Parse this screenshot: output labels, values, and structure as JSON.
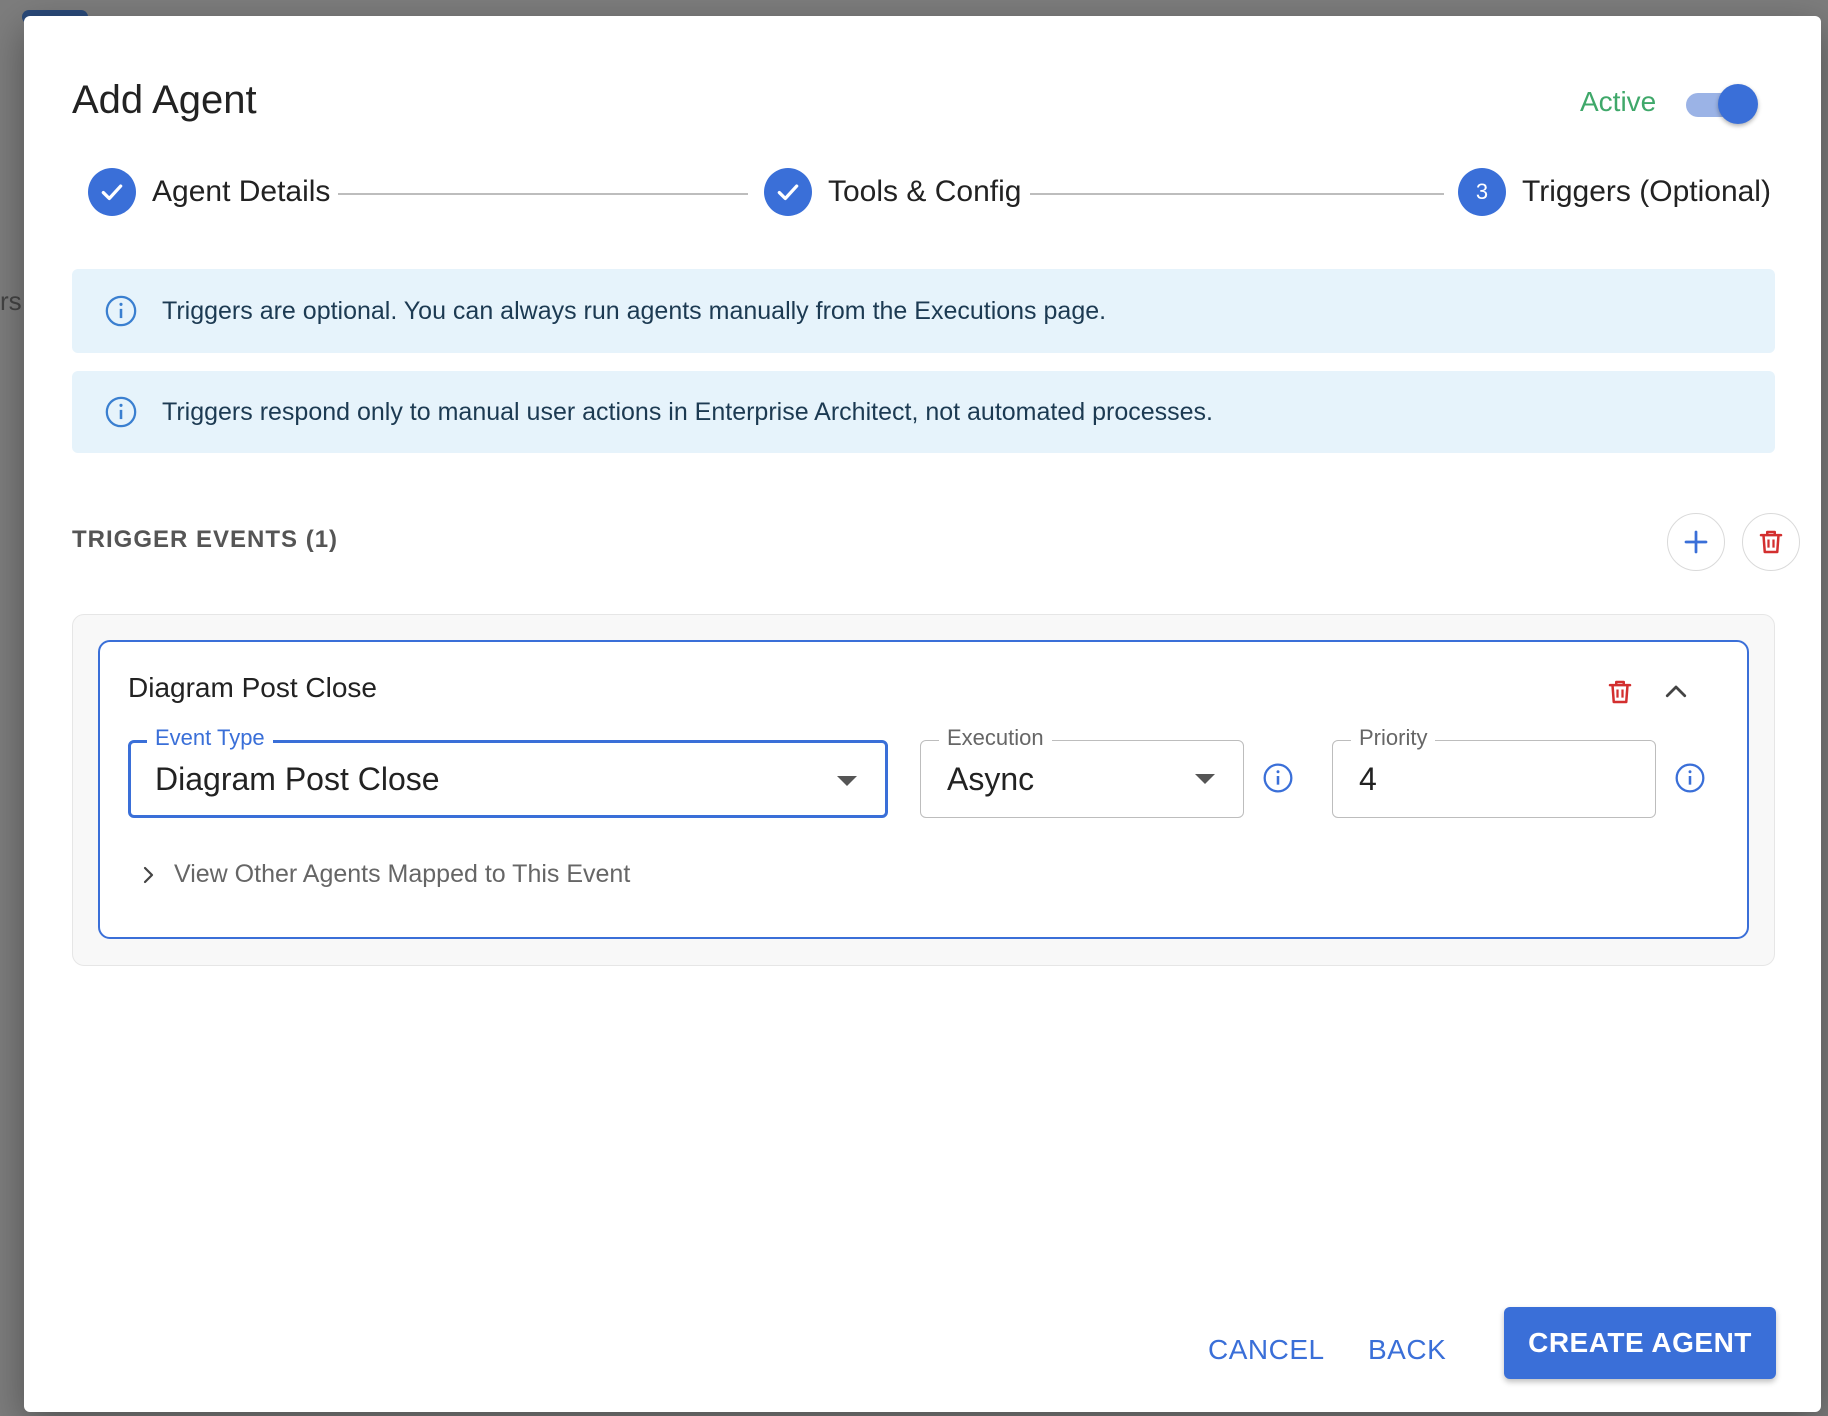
{
  "dialog": {
    "title": "Add Agent",
    "active_label": "Active",
    "active": true
  },
  "stepper": {
    "steps": [
      {
        "label": "Agent Details",
        "status": "completed",
        "icon": "check-icon"
      },
      {
        "label": "Tools & Config",
        "status": "completed",
        "icon": "check-icon"
      },
      {
        "label": "Triggers (Optional)",
        "status": "current",
        "number": "3"
      }
    ]
  },
  "alerts": [
    {
      "text": "Triggers are optional. You can always run agents manually from the Executions page.",
      "icon": "info-icon"
    },
    {
      "text": "Triggers respond only to manual user actions in Enterprise Architect, not automated processes.",
      "icon": "info-icon"
    }
  ],
  "trigger_events": {
    "title": "TRIGGER EVENTS (1)",
    "items": [
      {
        "title": "Diagram Post Close",
        "event_type": {
          "label": "Event Type",
          "value": "Diagram Post Close"
        },
        "execution": {
          "label": "Execution",
          "value": "Async"
        },
        "priority": {
          "label": "Priority",
          "value": "4"
        },
        "expander_label": "View Other Agents Mapped to This Event"
      }
    ]
  },
  "actions": {
    "cancel": "CANCEL",
    "back": "BACK",
    "create": "CREATE AGENT"
  },
  "colors": {
    "primary": "#3a6fd8",
    "active_green": "#3fa86a",
    "delete_red": "#d32f2f",
    "alert_bg": "#e6f3fb"
  }
}
